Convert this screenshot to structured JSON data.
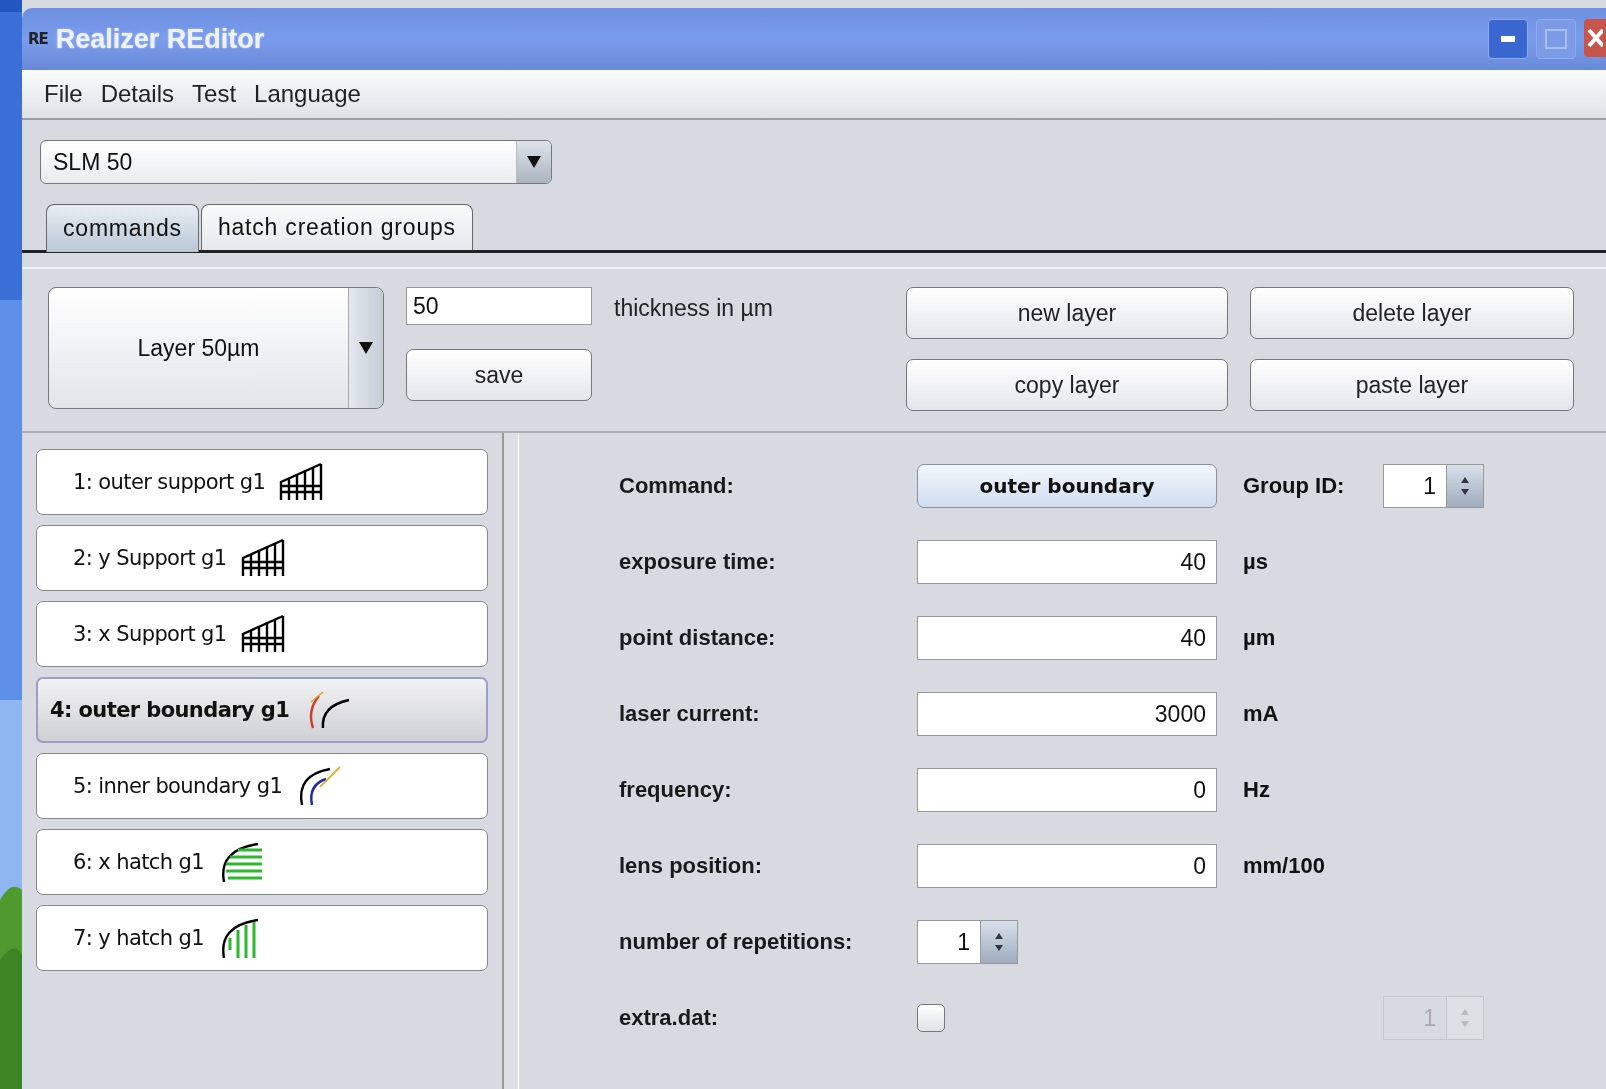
{
  "window": {
    "logo": "RE",
    "title": "Realizer REditor"
  },
  "menu": [
    "File",
    "Details",
    "Test",
    "Language"
  ],
  "machine_select": {
    "value": "SLM 50"
  },
  "tabs": [
    {
      "label": "commands",
      "selected": true
    },
    {
      "label": "hatch creation groups",
      "selected": false
    }
  ],
  "layer": {
    "select": "Layer 50µm",
    "thickness": "50",
    "thickness_label": "thickness in µm",
    "save": "save",
    "buttons": [
      "new layer",
      "delete layer",
      "copy layer",
      "paste layer"
    ]
  },
  "commands": [
    {
      "label": "1: outer support g1",
      "kind": "support",
      "selected": false
    },
    {
      "label": "2: y Support g1",
      "kind": "support",
      "selected": false
    },
    {
      "label": "3: x Support g1",
      "kind": "support",
      "selected": false
    },
    {
      "label": "4: outer boundary g1",
      "kind": "outer_boundary",
      "selected": true
    },
    {
      "label": "5: inner boundary g1",
      "kind": "inner_boundary",
      "selected": false
    },
    {
      "label": "6: x hatch g1",
      "kind": "x_hatch",
      "selected": false
    },
    {
      "label": "7: y hatch g1",
      "kind": "y_hatch",
      "selected": false
    }
  ],
  "form": {
    "command": {
      "label": "Command:",
      "value": "outer boundary"
    },
    "group_id": {
      "label": "Group ID:",
      "value": "1"
    },
    "fields": [
      {
        "label": "exposure time:",
        "value": "40",
        "unit": "µs"
      },
      {
        "label": "point distance:",
        "value": "40",
        "unit": "µm"
      },
      {
        "label": "laser current:",
        "value": "3000",
        "unit": "mA"
      },
      {
        "label": "frequency:",
        "value": "0",
        "unit": "Hz"
      },
      {
        "label": "lens position:",
        "value": "0",
        "unit": "mm/100"
      }
    ],
    "repetitions": {
      "label": "number of repetitions:",
      "value": "1"
    },
    "extra_dat": {
      "label": "extra.dat:",
      "checked": false,
      "count": "1",
      "count_disabled": true
    }
  }
}
